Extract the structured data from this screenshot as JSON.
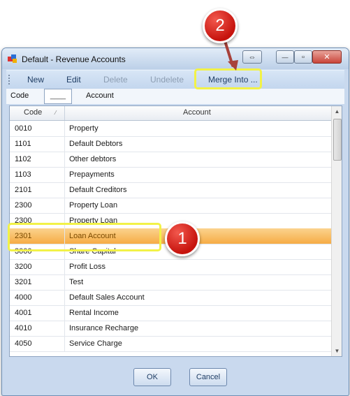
{
  "window": {
    "title": "Default - Revenue Accounts",
    "controls": {
      "restore": "⇔",
      "minimize": "—",
      "maximize": "▫",
      "close": "✕"
    }
  },
  "toolbar": {
    "new_label": "New",
    "edit_label": "Edit",
    "delete_label": "Delete",
    "undelete_label": "Undelete",
    "merge_label": "Merge Into ..."
  },
  "filter": {
    "code_label": "Code",
    "code_value": "____",
    "account_label": "Account"
  },
  "grid": {
    "columns": [
      "Code",
      "Account"
    ],
    "rows": [
      {
        "code": "0010",
        "account": "Property"
      },
      {
        "code": "1101",
        "account": "Default Debtors"
      },
      {
        "code": "1102",
        "account": "Other debtors"
      },
      {
        "code": "1103",
        "account": "Prepayments"
      },
      {
        "code": "2101",
        "account": "Default Creditors"
      },
      {
        "code": "2300",
        "account": "Property Loan"
      },
      {
        "code": "2300",
        "account": "Property Loan"
      },
      {
        "code": "2301",
        "account": "Loan Account"
      },
      {
        "code": "3000",
        "account": "Share Capital"
      },
      {
        "code": "3200",
        "account": "Profit Loss"
      },
      {
        "code": "3201",
        "account": "Test"
      },
      {
        "code": "4000",
        "account": "Default Sales Account"
      },
      {
        "code": "4001",
        "account": "Rental Income"
      },
      {
        "code": "4010",
        "account": "Insurance Recharge"
      },
      {
        "code": "4050",
        "account": "Service Charge"
      }
    ],
    "selected_index": 7
  },
  "buttons": {
    "ok_label": "OK",
    "cancel_label": "Cancel"
  },
  "callouts": {
    "step1": "1",
    "step2": "2"
  },
  "colors": {
    "highlight": "#f2f247",
    "badge": "#d3221a",
    "selection": "#f6ac45"
  }
}
